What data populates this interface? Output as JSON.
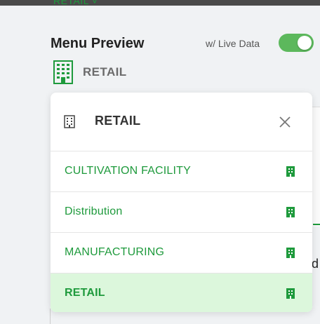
{
  "topbar": {
    "label": "RETAIL ˅"
  },
  "header": {
    "title": "Menu Preview",
    "live_data_label": "w/ Live Data",
    "live_data_on": true
  },
  "current_selection": {
    "label": "RETAIL",
    "icon": "building-icon"
  },
  "dropdown": {
    "header_label": "RETAIL",
    "header_icon": "building-icon",
    "close_icon": "close-icon",
    "items": [
      {
        "label": "CULTIVATION FACILITY",
        "icon": "building-icon",
        "selected": false
      },
      {
        "label": "Distribution",
        "icon": "building-icon",
        "selected": false
      },
      {
        "label": "MANUFACTURING",
        "icon": "building-icon",
        "selected": false
      },
      {
        "label": "RETAIL",
        "icon": "building-icon",
        "selected": true
      }
    ]
  },
  "background": {
    "partial_letter": "d"
  },
  "colors": {
    "accent": "#1e9a3c",
    "toggle": "#5cb85c",
    "selected_bg": "#dcf7dc"
  }
}
